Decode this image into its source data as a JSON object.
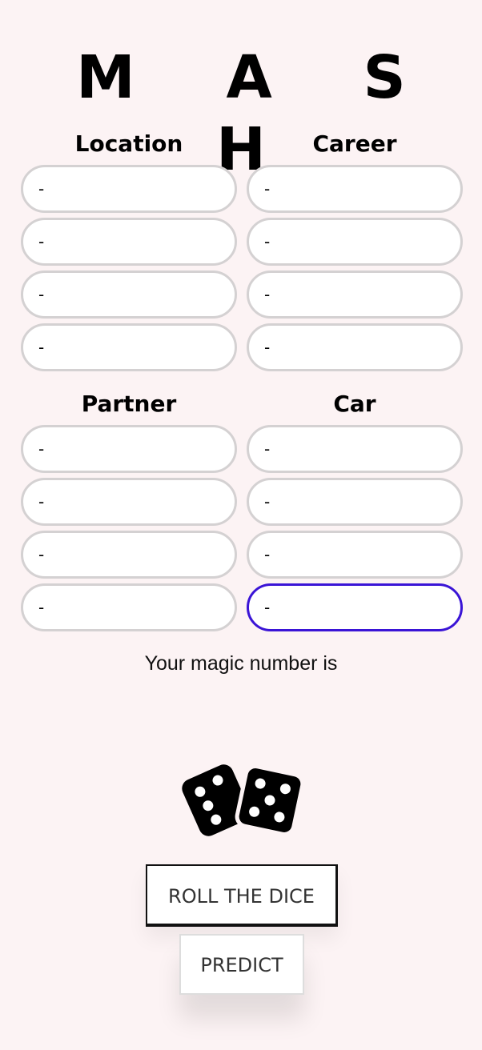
{
  "app": {
    "title": "M A S H"
  },
  "groups": [
    {
      "title": "Location",
      "values": [
        "-",
        "-",
        "-",
        "-"
      ]
    },
    {
      "title": "Career",
      "values": [
        "-",
        "-",
        "-",
        "-"
      ]
    },
    {
      "title": "Partner",
      "values": [
        "-",
        "-",
        "-",
        "-"
      ]
    },
    {
      "title": "Car",
      "values": [
        "-",
        "-",
        "-",
        "-"
      ]
    }
  ],
  "magic_label": "Your magic number is",
  "buttons": {
    "roll": "ROLL THE DICE",
    "predict": "PREDICT"
  },
  "icons": {
    "dice": "dice-icon"
  },
  "colors": {
    "background": "#fcf3f4",
    "focus_border": "#3a14d6",
    "field_border": "#d4d1d2"
  }
}
